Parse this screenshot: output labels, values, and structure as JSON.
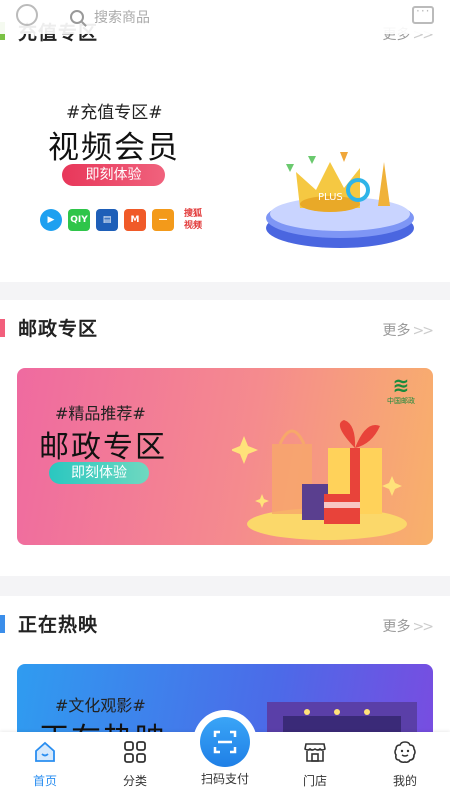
{
  "search": {
    "placeholder": "搜索商品"
  },
  "sections": [
    {
      "title": "充值专区",
      "more": "更多",
      "chevron": ">>",
      "accent": "#7ac143",
      "banner": {
        "tag": "#充值专区#",
        "title": "视频会员",
        "button": "即刻体验",
        "logos": [
          "tencent-video",
          "iqiyi",
          "youku",
          "mango-tv",
          "bilibili",
          "sohu-video"
        ],
        "logo_texts": {
          "iqiyi": "QIY",
          "sohu": "搜狐视频"
        },
        "illustration_text": "PLUS"
      }
    },
    {
      "title": "邮政专区",
      "more": "更多",
      "chevron": ">>",
      "accent": "#f25f7c",
      "banner": {
        "tag": "#精品推荐#",
        "title": "邮政专区",
        "button": "即刻体验",
        "brand_text": "中国邮政"
      }
    },
    {
      "title": "正在热映",
      "more": "更多",
      "chevron": ">>",
      "accent": "#3b8eea",
      "banner": {
        "tag": "#文化观影#",
        "title": "正在热映"
      }
    }
  ],
  "tabbar": {
    "items": [
      {
        "label": "首页",
        "icon": "home-icon",
        "active": true
      },
      {
        "label": "分类",
        "icon": "grid-icon",
        "active": false
      },
      {
        "label": "扫码支付",
        "icon": "scan-icon",
        "active": false
      },
      {
        "label": "门店",
        "icon": "store-icon",
        "active": false
      },
      {
        "label": "我的",
        "icon": "profile-icon",
        "active": false
      }
    ]
  },
  "colors": {
    "primary": "#2a8ef0",
    "pink": "#e8375a",
    "teal": "#2ac7c0"
  }
}
